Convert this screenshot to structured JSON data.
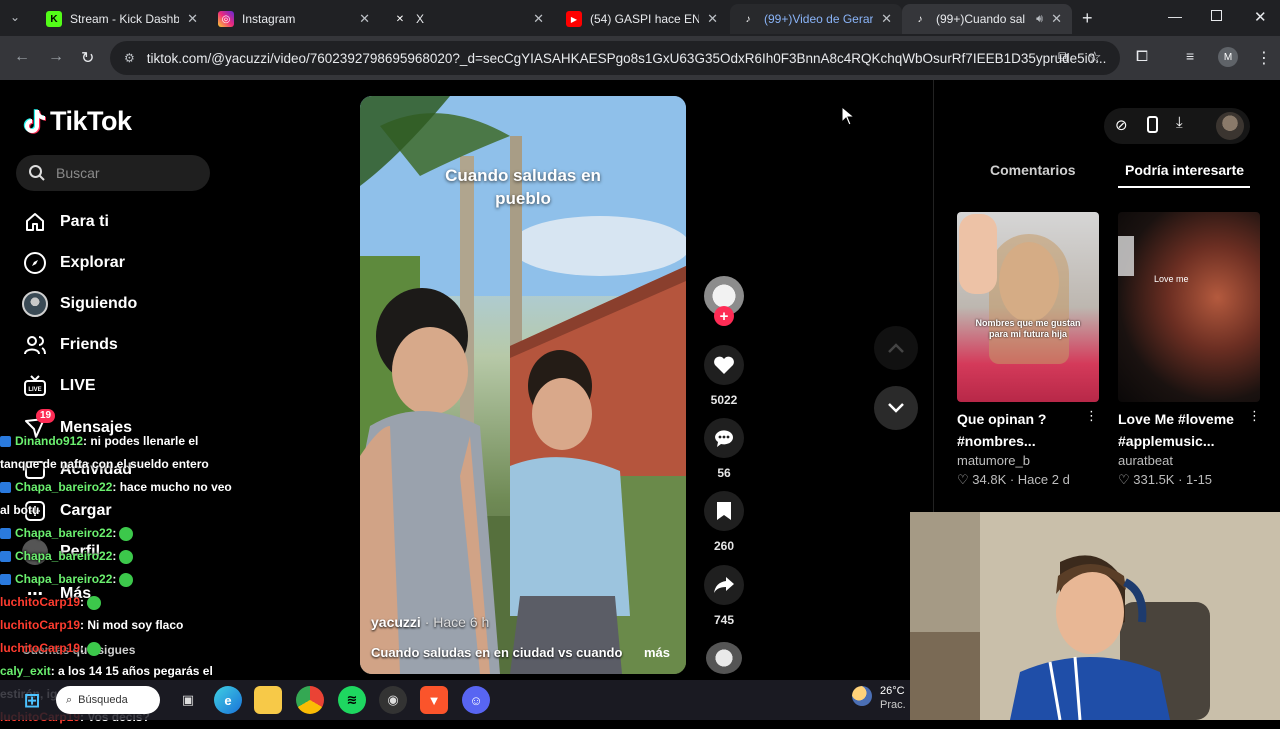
{
  "browser": {
    "tabs": [
      {
        "title": "Stream - Kick Dashbo",
        "favicon": "kick-icon",
        "color": "#53fc18",
        "glyph": "K"
      },
      {
        "title": "Instagram",
        "favicon": "instagram-icon",
        "color": "#d6249f",
        "glyph": "◎"
      },
      {
        "title": "X",
        "favicon": "x-icon",
        "color": "#202124",
        "glyph": "𝕏"
      },
      {
        "title": "(54) GASPI hace ENO",
        "favicon": "youtube-icon",
        "color": "#ff0000",
        "glyph": "▶"
      },
      {
        "title": "(99+)Video de Gerar",
        "favicon": "tiktok-icon",
        "color": "#202124",
        "glyph": "♪"
      },
      {
        "title": "(99+)Cuando sal",
        "favicon": "tiktok-icon",
        "color": "#202124",
        "glyph": "♪"
      }
    ],
    "url": "tiktok.com/@yacuzzi/video/7602392798695968020?_d=secCgYIASAHKAESPgo8s1GxU63G35OdxR6Ih0F3BnnA8c4RQKchqWbOsurRf7IEEB1D35yprude5i0..."
  },
  "tiktok": {
    "logo": "TikTok",
    "search_placeholder": "Buscar",
    "nav": [
      {
        "label": "Para ti",
        "icon": "home-icon"
      },
      {
        "label": "Explorar",
        "icon": "compass-icon"
      },
      {
        "label": "Siguiendo",
        "icon": "following-avatar-icon"
      },
      {
        "label": "Friends",
        "icon": "friends-icon"
      },
      {
        "label": "LIVE",
        "icon": "live-icon"
      },
      {
        "label": "Mensajes",
        "icon": "messages-icon",
        "badge": "19"
      },
      {
        "label": "Actividad",
        "icon": "activity-icon"
      },
      {
        "label": "Cargar",
        "icon": "upload-icon"
      },
      {
        "label": "Perfil",
        "icon": "profile-icon"
      },
      {
        "label": "Más",
        "icon": "more-icon"
      }
    ],
    "following_header": "Cuentas que sigues",
    "video": {
      "caption": "Cuando saludas en pueblo",
      "author": "yacuzzi",
      "time": "· Hace 6 h",
      "description": "Cuando saludas en en ciudad vs cuando",
      "more": "más"
    },
    "actions": {
      "likes": "5022",
      "comments": "56",
      "saves": "260",
      "shares": "745"
    },
    "panel_tabs": [
      "Comentarios",
      "Podría interesarte"
    ],
    "suggestions": [
      {
        "title": "Que opinan ?\n#nombres...",
        "user": "matumore_b",
        "meta": "♡ 34.8K · Hace 2 d",
        "overlay": "Nombres que me gustan para mi futura hija"
      },
      {
        "title": "Love Me #loveme\n#applemusic...",
        "user": "auratbeat",
        "meta": "♡ 331.5K · 1-15",
        "overlay": "Love me"
      }
    ]
  },
  "chat": [
    {
      "name": "Dinando912",
      "msg": ": ni podes llenarle el tanque de nafta con el sueldo entero",
      "red": false,
      "badge": true
    },
    {
      "name": "Chapa_bareiro22",
      "msg": ": hace mucho no veo al botu",
      "red": false,
      "badge": true
    },
    {
      "name": "Chapa_bareiro22",
      "msg": ":",
      "red": false,
      "badge": true,
      "emote": true
    },
    {
      "name": "Chapa_bareiro22",
      "msg": ":",
      "red": false,
      "badge": true,
      "emote": true
    },
    {
      "name": "Chapa_bareiro22",
      "msg": ":",
      "red": false,
      "badge": true,
      "emote": true
    },
    {
      "name": "luchitoCarp19",
      "msg": ":",
      "red": true,
      "badge": false,
      "emote": true
    },
    {
      "name": "luchitoCarp19",
      "msg": ": Ni mod soy flaco",
      "red": true,
      "badge": false
    },
    {
      "name": "luchitoCarp19",
      "msg": ":",
      "red": true,
      "badge": false,
      "emote": true
    },
    {
      "name": "caly_exit",
      "msg": ": a los 14 15 años pegarás el estirón, igual que yo",
      "red": false,
      "badge": false
    },
    {
      "name": "luchitoCarp19",
      "msg": ": Vos decís?",
      "red": true,
      "badge": false
    }
  ],
  "taskbar": {
    "search_placeholder": "Búsqueda",
    "weather_temp": "26°C",
    "weather_desc": "Prac."
  },
  "colors": {
    "accent_red": "#fe2c55",
    "chat_green": "#6bf06f",
    "chat_red": "#ff3c2f"
  }
}
